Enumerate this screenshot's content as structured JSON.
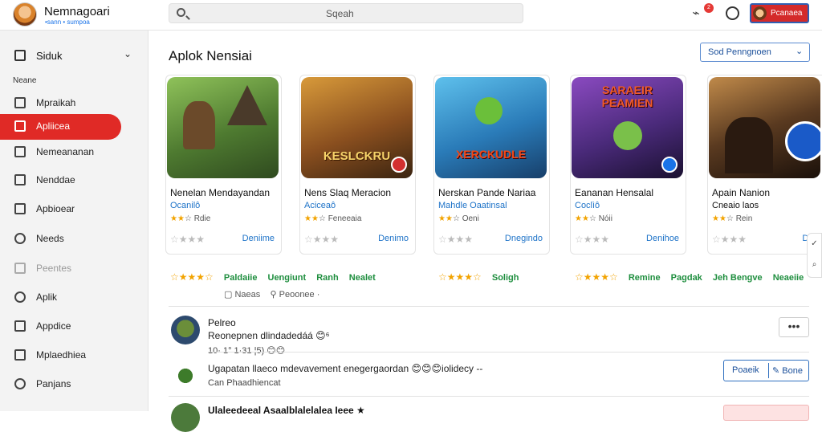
{
  "brand": {
    "title": "Nemnagoari",
    "subtitle": "•sann • sumpoa"
  },
  "search": {
    "placeholder": "Sqeah"
  },
  "header": {
    "notification_count": "2",
    "profile_label": "Pcanaea"
  },
  "sidebar": {
    "header_label": "Siduk",
    "section_label": "Neane",
    "items": [
      {
        "label": "Mpraikah",
        "icon": "square-icon"
      },
      {
        "label": "Apliicea",
        "icon": "square-icon",
        "active": true
      },
      {
        "label": "Nemeananan",
        "icon": "square-icon"
      },
      {
        "label": "Nenddae",
        "icon": "image-icon"
      },
      {
        "label": "Apbioear",
        "icon": "square-icon"
      },
      {
        "label": "Needs",
        "icon": "search-icon"
      },
      {
        "label": "Peentes",
        "icon": "square-icon",
        "faded": true
      },
      {
        "label": "Aplik",
        "icon": "circle-icon"
      },
      {
        "label": "Appdice",
        "icon": "square-icon"
      },
      {
        "label": "Mplaedhiea",
        "icon": "square-icon"
      },
      {
        "label": "Panjans",
        "icon": "circle-icon"
      }
    ]
  },
  "main": {
    "title": "Aplok Nensiai",
    "sort_label": "Sod Penngnoen"
  },
  "cards": [
    {
      "thumb_text": "",
      "title": "Nenelan Mendayandan",
      "subtitle": "Ocanilô",
      "rating": "Rdie",
      "action": "Deniime",
      "thumb_colors": [
        "#6fa24a",
        "#3c5a2a"
      ],
      "badge": ""
    },
    {
      "thumb_text": "KESLCKRU",
      "title": "Nens Slaq Meracion",
      "subtitle": "Aciceaô",
      "rating": "Feneeaia",
      "action": "Denimo",
      "thumb_colors": [
        "#c07a2a",
        "#5a3a1a"
      ],
      "badge": "#d32f2f"
    },
    {
      "thumb_text": "XERCKUDLE",
      "title": "Nerskan Pande Nariaa",
      "subtitle": "Mahdle Oaatinsal",
      "rating": "Oeni",
      "action": "Dnegindo",
      "thumb_colors": [
        "#3aa0d8",
        "#1c4f7a"
      ],
      "badge": ""
    },
    {
      "thumb_text": "SARAEIR PEAMIEN",
      "title": "Eananan Hensalal",
      "subtitle": "Coclìô",
      "rating": "Nóii",
      "action": "Denihoe",
      "thumb_colors": [
        "#7a3a9a",
        "#2a1a4a"
      ],
      "badge": "#1a73e8"
    },
    {
      "thumb_text": "",
      "title": "Apain Nanion",
      "subtitle": "Cneaio laos",
      "rating": "Rein",
      "action": "Denici",
      "thumb_colors": [
        "#8a5a3a",
        "#2a1a10"
      ],
      "badge": "#1a73e8"
    }
  ],
  "meta_rows": [
    {
      "tags": [
        "Paldaiie",
        "Uengiunt",
        "Ranh",
        "Nealet"
      ]
    },
    {
      "tags": [
        "Soligh"
      ]
    },
    {
      "tags": [
        "Remine",
        "Pagdak",
        "Jeh Bengve",
        "Neaeiie"
      ]
    }
  ],
  "sub_meta": {
    "a": "Naeas",
    "b": "Peoonee ·"
  },
  "posts": [
    {
      "name": "Pelreo",
      "text": "Reonepnen dlindadedáá 😊⁶",
      "time": "10· 1° 1·31 ¦5) 😊😊"
    },
    {
      "text": "Ugapatan llaeco mdevavement enegergaordan 😊😊😊iolidecy --",
      "sub": "Can Phaadhiencat",
      "btn_a": "Poaeik",
      "btn_b": "Bone"
    },
    {
      "text": "Ulaleedeeal Asaalblalelalea Ieee ★"
    }
  ],
  "more_label": "•••"
}
